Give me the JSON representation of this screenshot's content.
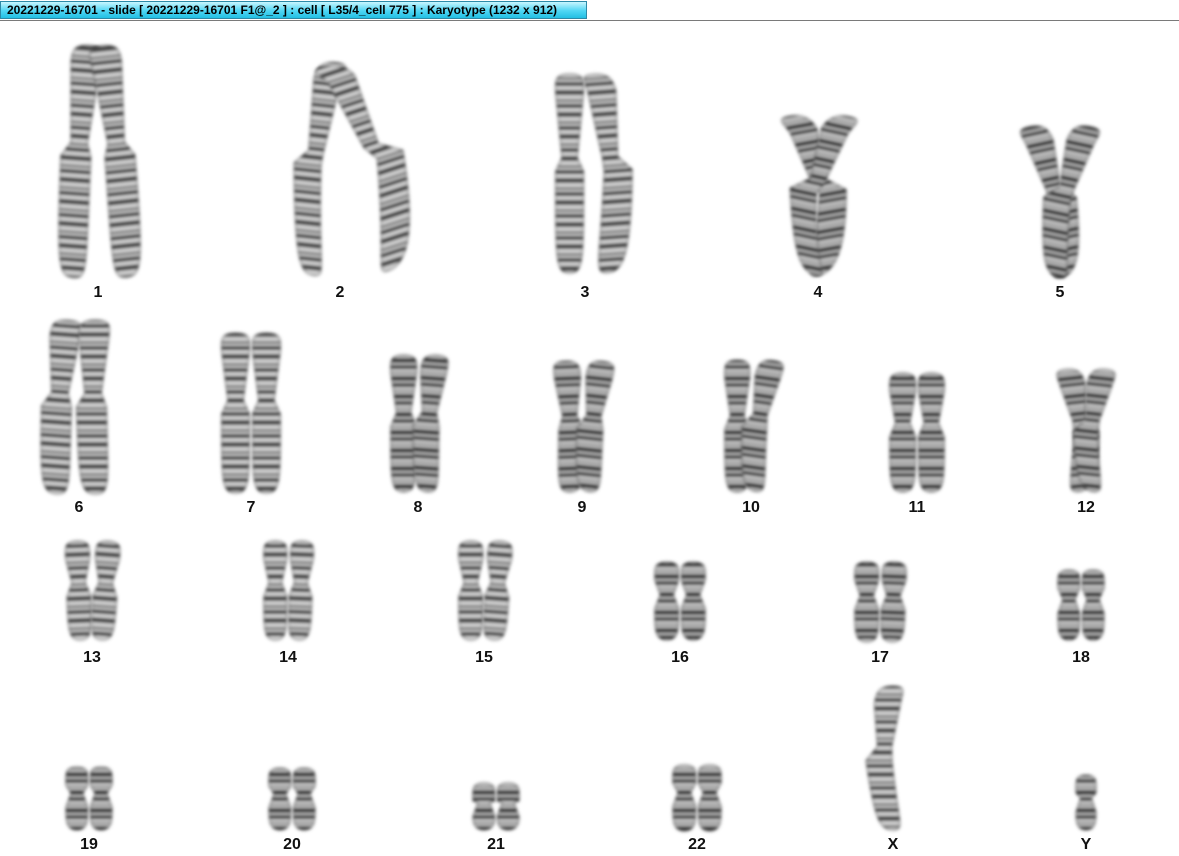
{
  "window": {
    "title": "20221229-16701 - slide [ 20221229-16701 F1@_2 ] : cell [ L35/4_cell 775 ] : Karyotype  (1232 x 912)"
  },
  "karyotype": {
    "labels": [
      "1",
      "2",
      "3",
      "4",
      "5",
      "6",
      "7",
      "8",
      "9",
      "10",
      "11",
      "12",
      "13",
      "14",
      "15",
      "16",
      "17",
      "18",
      "19",
      "20",
      "21",
      "22",
      "X",
      "Y"
    ]
  }
}
